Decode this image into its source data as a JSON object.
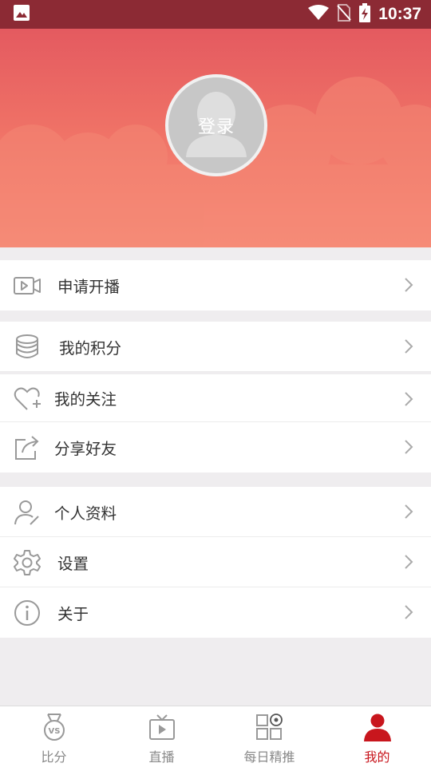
{
  "status_bar": {
    "time": "10:37"
  },
  "profile": {
    "login_label": "登录"
  },
  "menu": {
    "apply_stream": "申请开播",
    "my_points": "我的积分",
    "my_follows": "我的关注",
    "share_friends": "分享好友",
    "profile_info": "个人资料",
    "settings": "设置",
    "about": "关于"
  },
  "tabs": [
    {
      "label": "比分",
      "icon": "medal-vs-icon",
      "active": false
    },
    {
      "label": "直播",
      "icon": "tv-icon",
      "active": false
    },
    {
      "label": "每日精推",
      "icon": "grid-ball-icon",
      "active": false
    },
    {
      "label": "我的",
      "icon": "user-icon",
      "active": true
    }
  ],
  "colors": {
    "accent": "#c8161d",
    "status_bar": "#8c2a34",
    "hero_top": "#e45a60",
    "hero_bottom": "#f8917b"
  }
}
